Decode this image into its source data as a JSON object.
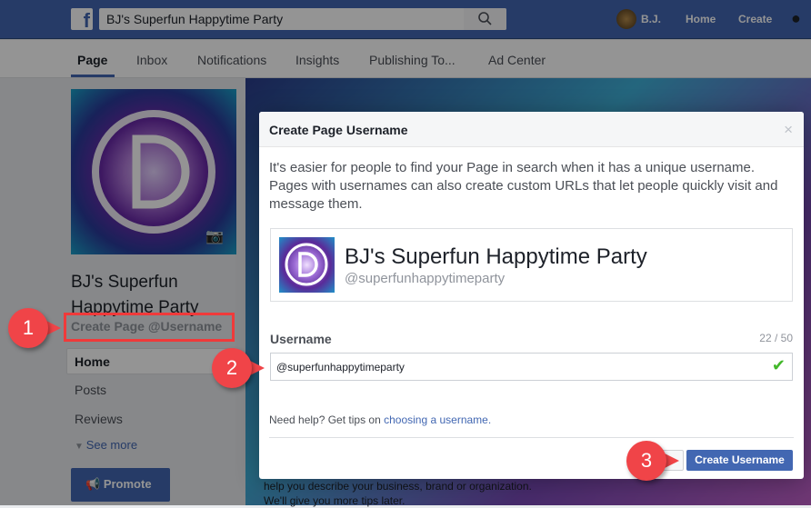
{
  "topbar": {
    "search_value": "BJ's Superfun Happytime Party",
    "user": "B.J.",
    "home": "Home",
    "create": "Create"
  },
  "tabs": [
    "Page",
    "Inbox",
    "Notifications",
    "Insights",
    "Publishing To...",
    "Ad Center"
  ],
  "sidebar": {
    "page_name": "BJ's Superfun Happytime Party",
    "create_username": "Create Page @Username",
    "items": [
      "Home",
      "Posts",
      "Reviews"
    ],
    "see_more": "See more",
    "promote": "Promote"
  },
  "behind": {
    "text1": "help you describe your business, brand or organization.",
    "text2": "We'll give you more tips later."
  },
  "modal": {
    "title": "Create Page Username",
    "close": "×",
    "intro": "It's easier for people to find your Page in search when it has a unique username. Pages with usernames can also create custom URLs that let people quickly visit and message them.",
    "preview_name": "BJ's Superfun Happytime Party",
    "preview_handle": "@superfunhappytimeparty",
    "username_label": "Username",
    "char_count": "22 / 50",
    "username_value": "@superfunhappytimeparty",
    "help_text": "Need help? Get tips on ",
    "help_link": "choosing a username.",
    "create_button": "Create Username"
  },
  "callouts": [
    "1",
    "2",
    "3"
  ]
}
